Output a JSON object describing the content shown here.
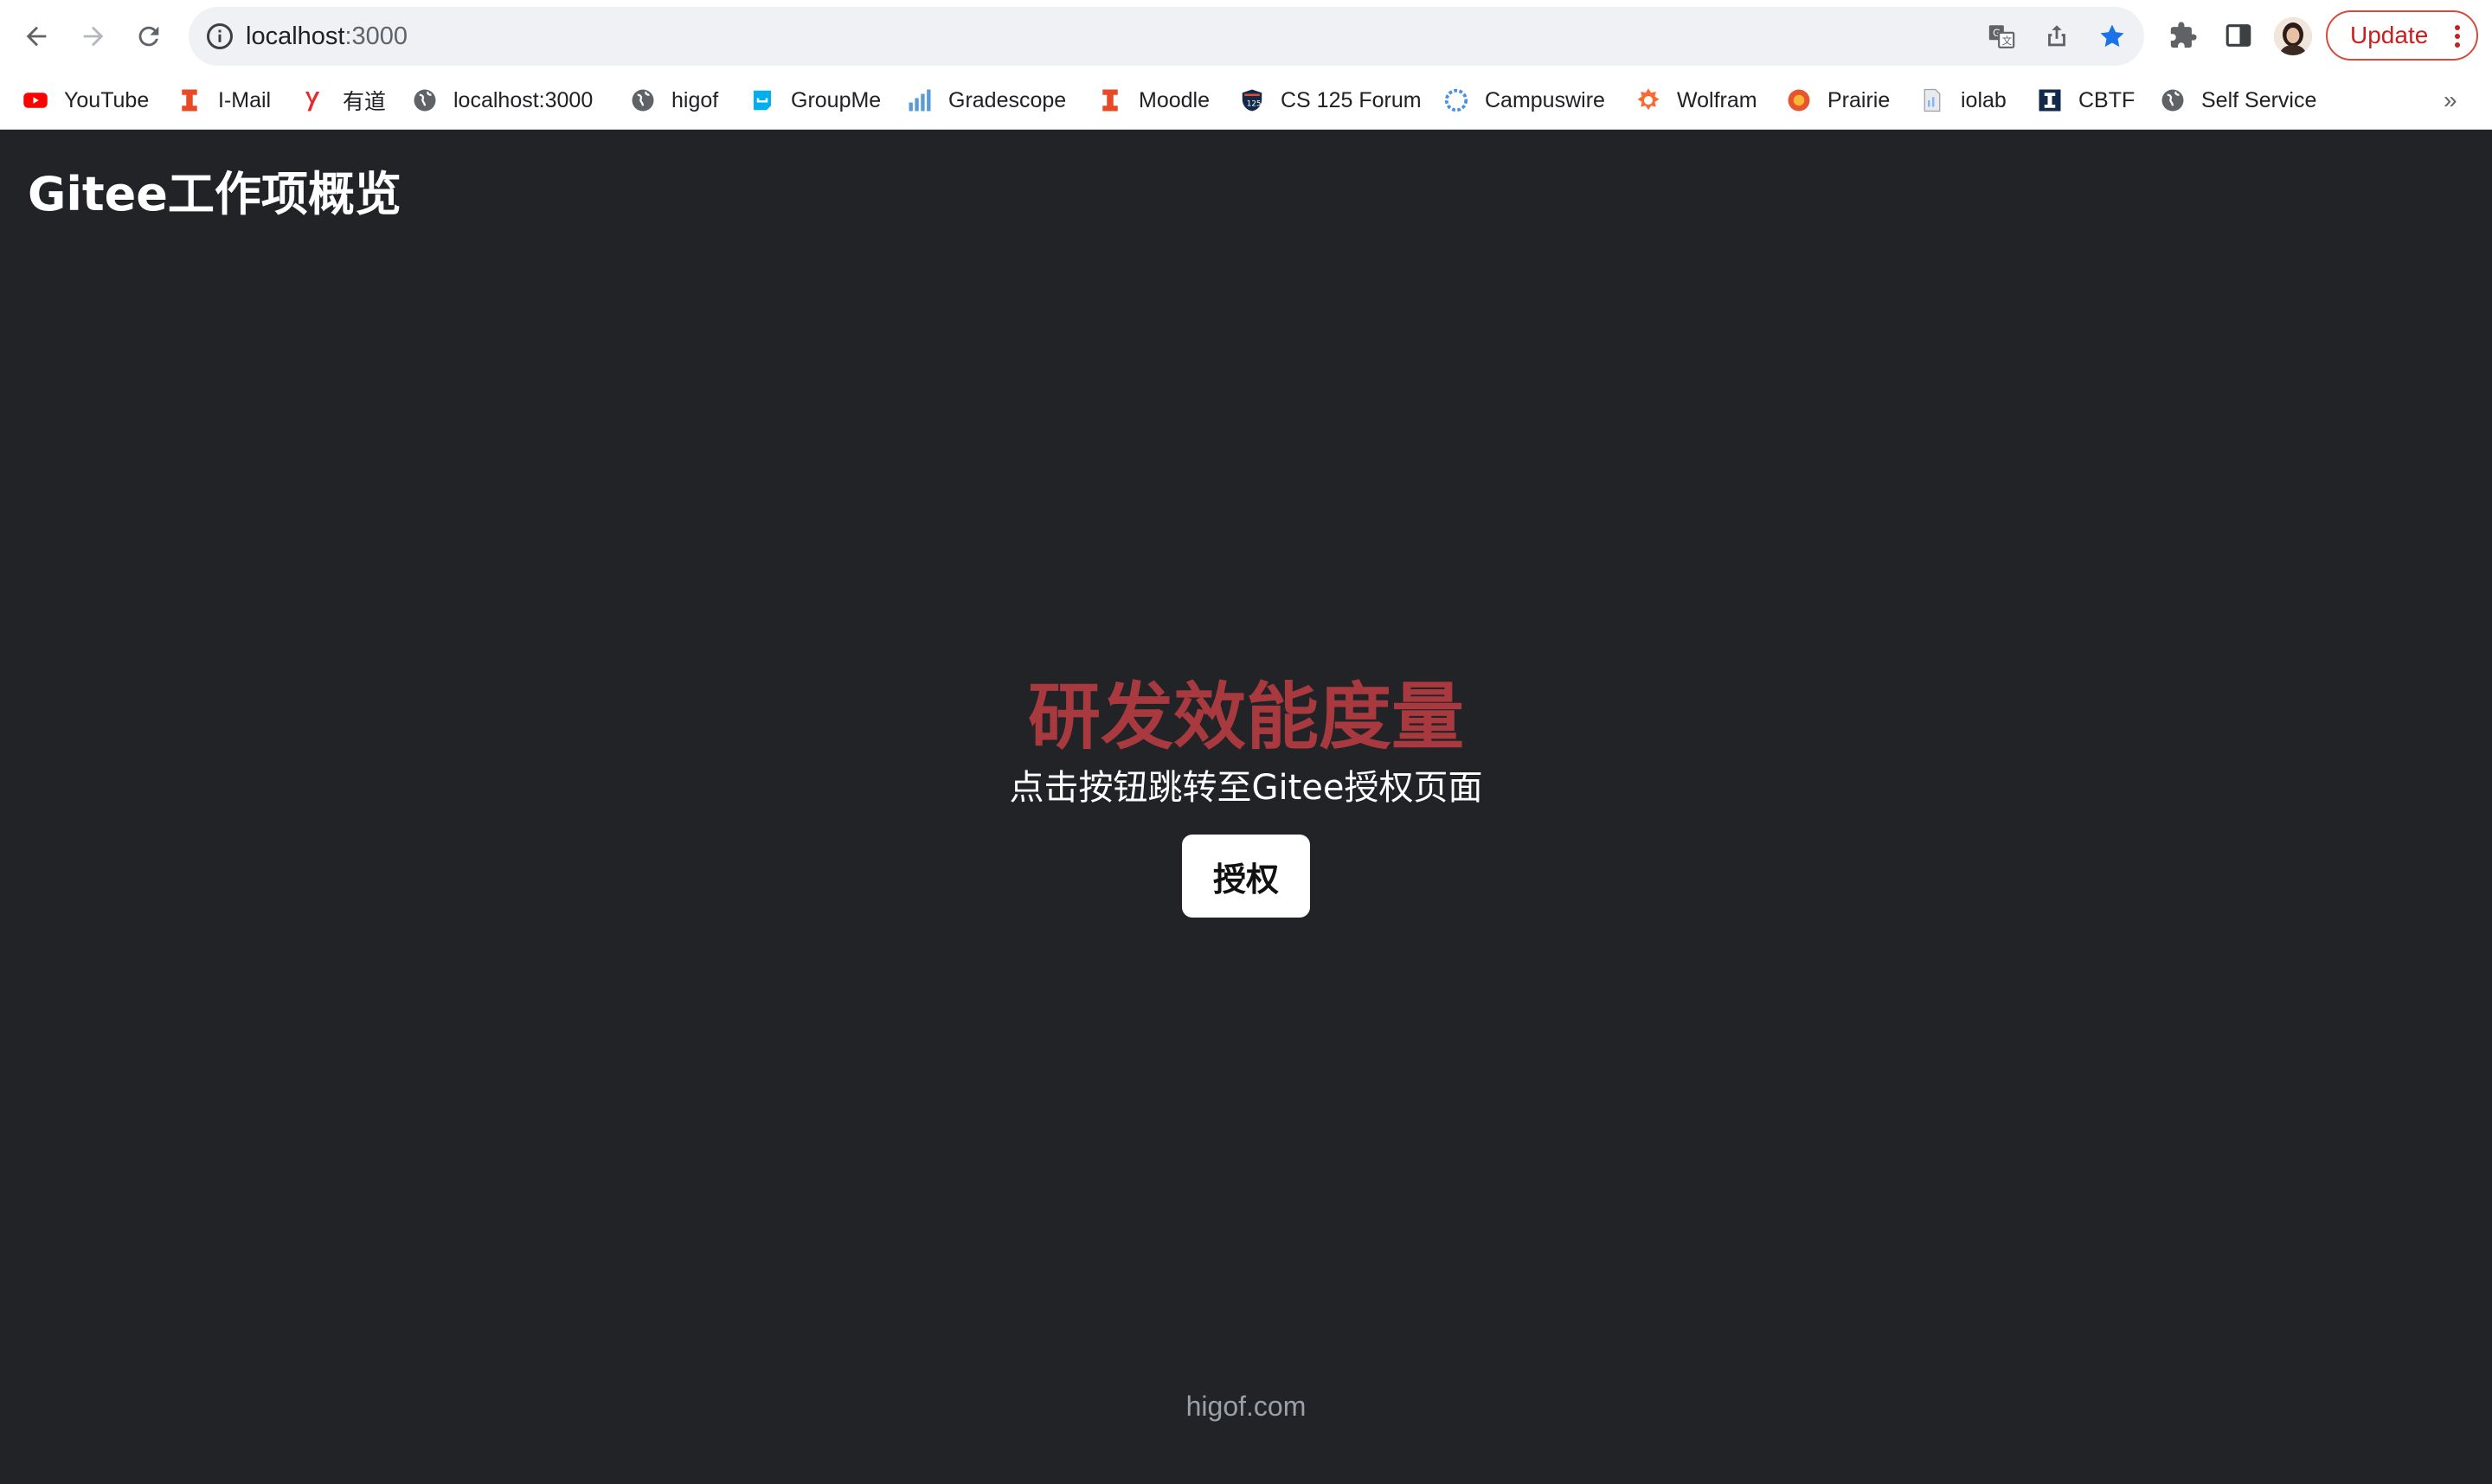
{
  "browser": {
    "url_host": "localhost",
    "url_port": ":3000",
    "update_label": "Update",
    "bookmarks": [
      {
        "label": "YouTube",
        "icon": "youtube-icon"
      },
      {
        "label": "I-Mail",
        "icon": "illinois-icon"
      },
      {
        "label": "有道",
        "icon": "youdao-icon"
      },
      {
        "label": "localhost:3000",
        "icon": "globe-icon"
      },
      {
        "label": "higof",
        "icon": "globe-icon"
      },
      {
        "label": "GroupMe",
        "icon": "groupme-icon"
      },
      {
        "label": "Gradescope",
        "icon": "gradescope-icon"
      },
      {
        "label": "Moodle",
        "icon": "illinois-icon"
      },
      {
        "label": "CS 125 Forum",
        "icon": "forum-shield-icon"
      },
      {
        "label": "Campuswire",
        "icon": "campuswire-icon"
      },
      {
        "label": "Wolfram",
        "icon": "wolfram-icon"
      },
      {
        "label": "Prairie",
        "icon": "prairie-icon"
      },
      {
        "label": "iolab",
        "icon": "document-icon"
      },
      {
        "label": "CBTF",
        "icon": "illinois-block-icon"
      },
      {
        "label": "Self Service",
        "icon": "globe-icon"
      }
    ],
    "more_label": "»"
  },
  "page": {
    "header_title": "Gitee工作项概览",
    "hero_title": "研发效能度量",
    "hero_subtitle": "点击按钮跳转至Gitee授权页面",
    "auth_button_label": "授权",
    "footer_text": "higof.com"
  },
  "colors": {
    "page_background": "#212327",
    "hero_title": "#a83a3f",
    "accent_blue": "#1a73e8"
  }
}
